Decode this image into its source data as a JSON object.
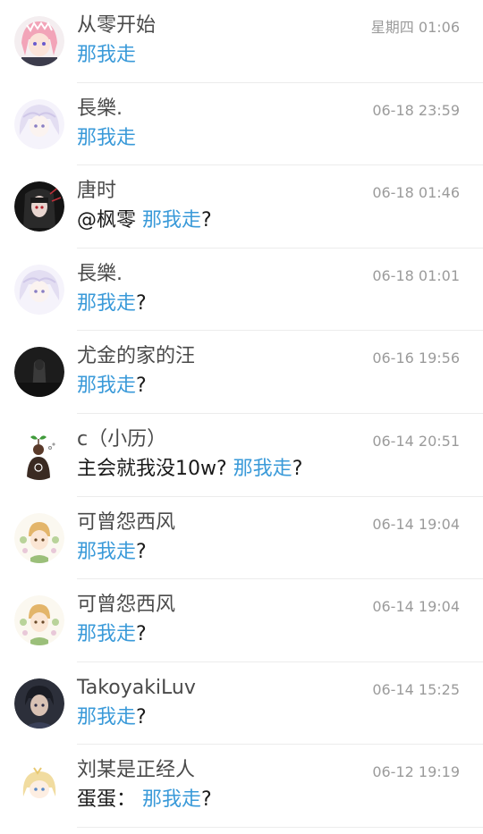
{
  "colors": {
    "link": "#3a9ad9",
    "name": "#4a4a4a",
    "time": "#9b9b9b",
    "divider": "#ececec"
  },
  "messages": [
    {
      "avatar": "pink-hair-anime-avatar",
      "name": "从零开始",
      "time": "星期四 01:06",
      "prefix": "",
      "link": "那我走",
      "suffix": ""
    },
    {
      "avatar": "white-hair-anime-avatar",
      "name": "長樂.",
      "time": "06-18 23:59",
      "prefix": "",
      "link": "那我走",
      "suffix": ""
    },
    {
      "avatar": "dark-hair-girl-avatar",
      "name": "唐时",
      "time": "06-18 01:46",
      "prefix": "@枫零 ",
      "link": "那我走",
      "suffix": "?"
    },
    {
      "avatar": "white-hair-anime-avatar",
      "name": "長樂.",
      "time": "06-18 01:01",
      "prefix": "",
      "link": "那我走",
      "suffix": "?"
    },
    {
      "avatar": "dark-hooded-figure-avatar",
      "name": "尤金的家的汪",
      "time": "06-16 19:56",
      "prefix": "",
      "link": "那我走",
      "suffix": "?"
    },
    {
      "avatar": "sprout-head-character-avatar",
      "name": "c（小历）",
      "time": "06-14 20:51",
      "prefix": "主会就我没10w? ",
      "link": "那我走",
      "suffix": "?"
    },
    {
      "avatar": "blond-boy-flowers-avatar",
      "name": "可曾怨西风",
      "time": "06-14 19:04",
      "prefix": "",
      "link": "那我走",
      "suffix": "?"
    },
    {
      "avatar": "blond-boy-flowers-avatar",
      "name": "可曾怨西风",
      "time": "06-14 19:04",
      "prefix": "",
      "link": "那我走",
      "suffix": "?"
    },
    {
      "avatar": "dark-hair-boy-avatar",
      "name": "TakoyakiLuv",
      "time": "06-14 15:25",
      "prefix": "",
      "link": "那我走",
      "suffix": "?"
    },
    {
      "avatar": "blond-chibi-girl-avatar",
      "name": "刘某是正经人",
      "time": "06-12 19:19",
      "prefix": "蛋蛋： ",
      "link": "那我走",
      "suffix": "?"
    }
  ]
}
